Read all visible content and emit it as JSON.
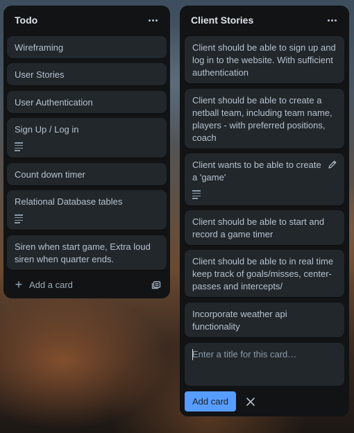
{
  "lists": [
    {
      "title": "Todo",
      "cards": [
        {
          "text": "Wireframing"
        },
        {
          "text": "User Stories"
        },
        {
          "text": "User Authentication"
        },
        {
          "text": "Sign Up / Log in",
          "has_description": true
        },
        {
          "text": "Count down timer"
        },
        {
          "text": "Relational Database tables",
          "has_description": true
        },
        {
          "text": "Siren when start game, Extra loud siren when quarter ends."
        }
      ],
      "add_card_label": "Add a card"
    },
    {
      "title": "Client Stories",
      "cards": [
        {
          "text": "Client should be able to sign up and log in to the website. With sufficient authentication"
        },
        {
          "text": "Client should be able to create a netball team, including team name, players - with preferred positions, coach"
        },
        {
          "text": "Client wants to be able to create a 'game'",
          "has_description": true
        },
        {
          "text": "Client should be able to start and record a game timer"
        },
        {
          "text": "Client should be able to in real time keep track of goals/misses, center-passes and intercepts/"
        },
        {
          "text": "Incorporate weather api functionality"
        }
      ],
      "composer": {
        "placeholder": "Enter a title for this card…",
        "value": "",
        "submit_label": "Add card"
      }
    }
  ],
  "icons": {
    "list_menu": "more-horizontal-icon",
    "description": "description-lines-icon",
    "edit": "pencil-icon",
    "add": "plus-icon",
    "template": "card-template-icon",
    "close": "close-icon"
  },
  "colors": {
    "list_bg": "#111315",
    "card_bg": "#22272b",
    "text": "#b6c2cf",
    "accent_button": "#579dff"
  }
}
